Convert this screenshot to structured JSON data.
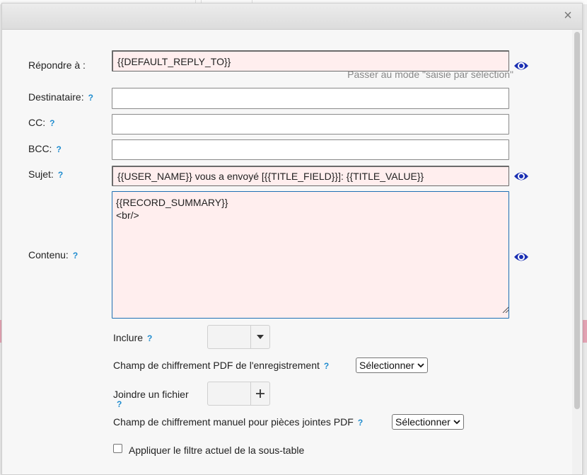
{
  "dialog": {
    "close_glyph": "×"
  },
  "form": {
    "reply_to": {
      "label": "Répondre à :",
      "value": "{{DEFAULT_REPLY_TO}}",
      "hint": "Passer au mode \"saisie par sélection\""
    },
    "recipient": {
      "label": "Destinataire:",
      "help": "?",
      "value": ""
    },
    "cc": {
      "label": "CC:",
      "help": "?",
      "value": ""
    },
    "bcc": {
      "label": "BCC:",
      "help": "?",
      "value": ""
    },
    "subject": {
      "label": "Sujet:",
      "help": "?",
      "value": "{{USER_NAME}} vous a envoyé [{{TITLE_FIELD}}]: {{TITLE_VALUE}}"
    },
    "content": {
      "label": "Contenu:",
      "help": "?",
      "value": "{{RECORD_SUMMARY}}\n<br/>"
    },
    "include": {
      "label": "Inclure",
      "help": "?"
    },
    "pdf_encryption": {
      "label": "Champ de chiffrement PDF de l'enregistrement",
      "help": "?",
      "selected": "Sélectionner"
    },
    "attach": {
      "label": "Joindre un fichier",
      "help": "?"
    },
    "manual_pdf_encryption": {
      "label": "Champ de chiffrement manuel pour pièces jointes PDF",
      "help": "?",
      "selected": "Sélectionner"
    },
    "apply_filter": {
      "label": "Appliquer le filtre actuel de la sous-table",
      "checked": false
    }
  },
  "icons": {
    "eye": "eye-icon",
    "dropdown": "caret-down-icon",
    "add": "plus-icon"
  },
  "colors": {
    "eye": "#1a2fb3",
    "help": "#1f8ccf",
    "field_pink": "#ffeeee"
  }
}
